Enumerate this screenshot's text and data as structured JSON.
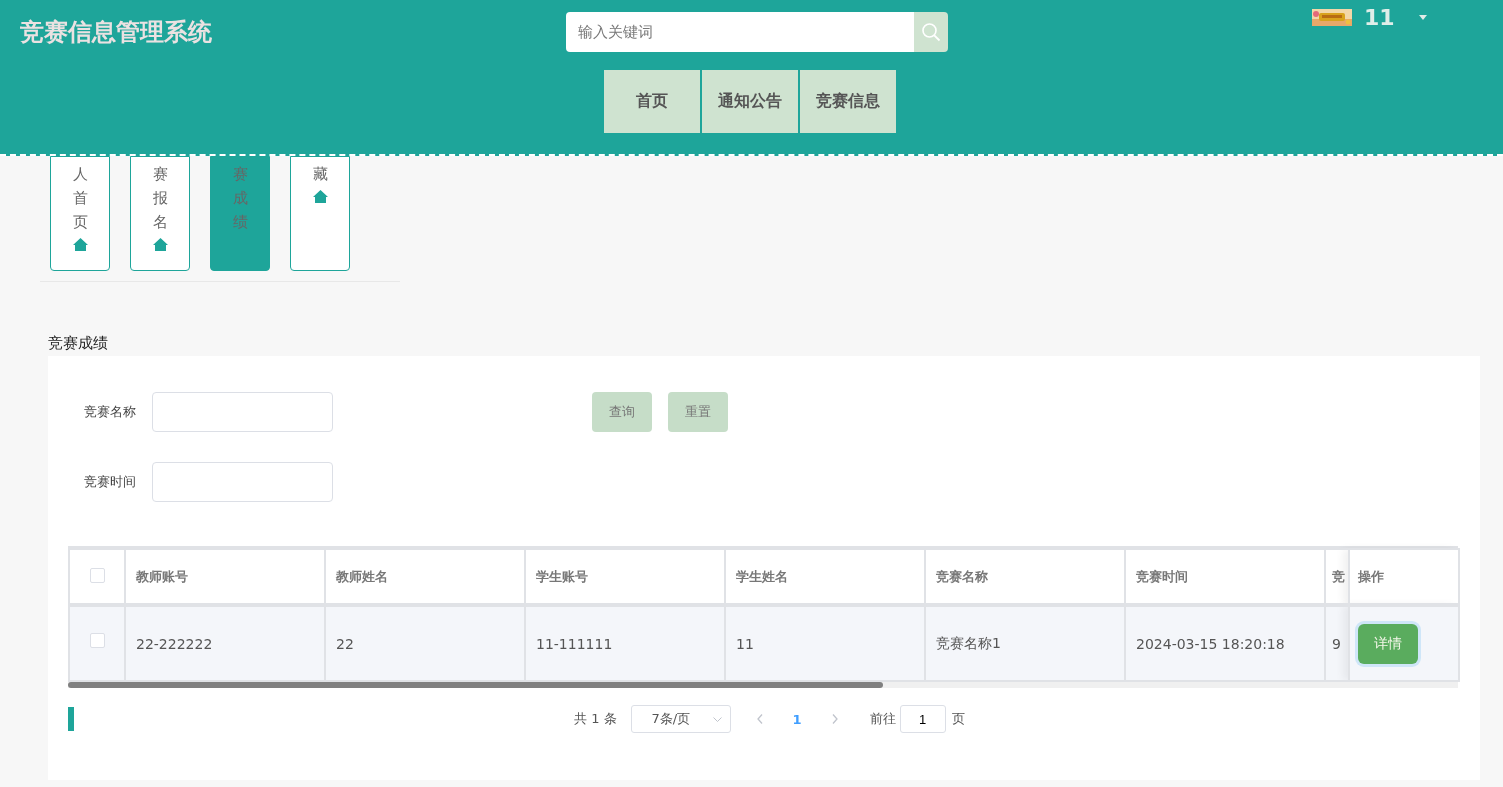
{
  "header": {
    "title": "竞赛信息管理系统",
    "search": {
      "placeholder": "输入关键词"
    },
    "user": {
      "name": "11"
    }
  },
  "nav": [
    {
      "label": "首页"
    },
    {
      "label": "通知公告"
    },
    {
      "label": "竞赛信息"
    }
  ],
  "side_tabs": [
    {
      "label": "人首页",
      "selected": false
    },
    {
      "label": "赛报名",
      "selected": false
    },
    {
      "label": "赛成绩",
      "selected": true
    },
    {
      "label": "藏",
      "selected": false
    }
  ],
  "section_title": "竞赛成绩",
  "filters": [
    {
      "label": "竞赛名称"
    },
    {
      "label": "竞赛时间"
    }
  ],
  "buttons": [
    "查询",
    "重置"
  ],
  "table": {
    "select_all_checked": false,
    "columns": [
      "教师账号",
      "教师姓名",
      "学生账号",
      "学生姓名",
      "竞赛名称",
      "竞赛时间",
      "竞"
    ],
    "action_column": "操作",
    "rows": [
      {
        "checked": false,
        "cells": [
          "22-222222",
          "22",
          "11-111111",
          "11",
          "竞赛名称1",
          "2024-03-15 18:20:18",
          "9"
        ],
        "actions": [
          "详情"
        ]
      }
    ]
  },
  "pagination": {
    "total": "共 1 条",
    "page_size": "7条/页",
    "pages": [
      {
        "label": "1",
        "selected": true
      }
    ],
    "goto_label": "前往",
    "goto_value": "1",
    "goto_suffix": "页"
  }
}
